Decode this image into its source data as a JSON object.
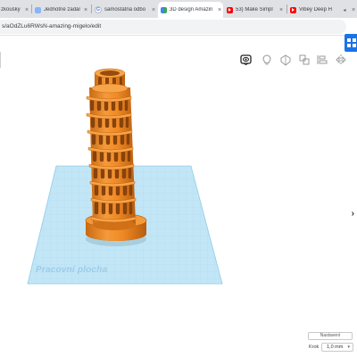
{
  "browser": {
    "tabs": [
      {
        "title": "zkoušky",
        "favicon": "generic"
      },
      {
        "title": "Jednotné zadání",
        "favicon": "generic"
      },
      {
        "title": "samostatná odbo",
        "favicon": "google"
      },
      {
        "title": "3D design Amazin",
        "favicon": "tinkercad",
        "active": true
      },
      {
        "title": "53) Make Simpl",
        "favicon": "youtube"
      },
      {
        "title": "Vibey Deep H",
        "favicon": "youtube"
      }
    ],
    "close_glyph": "×",
    "address": "s/aOdZLu6RWsN-amazing-migelo/edit"
  },
  "toolbar": {
    "icons": [
      "view-icon",
      "bulb-icon",
      "shield-icon",
      "group-icon",
      "align-icon",
      "mirror-icon"
    ]
  },
  "workspace": {
    "workplane_label": "Pracovní plocha",
    "snap_button": "Nastavení",
    "grid_label": "Krok",
    "grid_value": "1,0 mm",
    "next_arrow": "›"
  },
  "colors": {
    "tower_orange": "#f08a24",
    "tower_dark": "#b85d10",
    "workplane_blue": "#bfe4f5",
    "grid_line": "#9fd3ec",
    "accent_blue": "#1a73e8"
  }
}
